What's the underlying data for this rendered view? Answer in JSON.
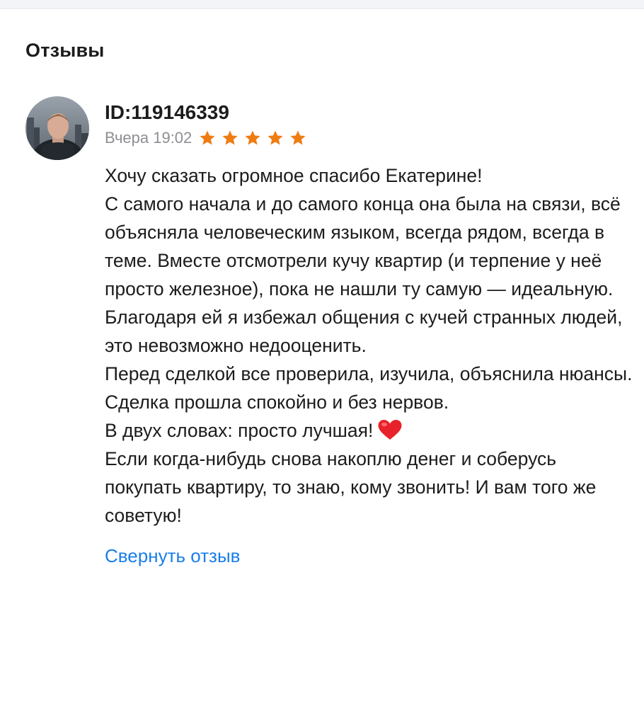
{
  "section": {
    "title": "Отзывы"
  },
  "review": {
    "author": "ID:119146339",
    "date": "Вчера 19:02",
    "rating": 5,
    "lines": [
      "Хочу сказать огромное спасибо Екатерине!",
      "С самого начала и до самого конца она была на связи, всё объясняла человеческим языком, всегда рядом, всегда в теме. Вместе отсмотрели кучу квартир (и терпение у неё просто железное), пока не нашли ту самую — идеальную.",
      "Благодаря ей я избежал общения с кучей странных людей, это невозможно недооценить.",
      "Перед сделкой все проверила, изучила, объяснила нюансы. Сделка прошла спокойно и без нервов.",
      "В двух словах: просто лучшая!",
      "Если когда-нибудь снова накоплю денег и соберусь покупать квартиру, то знаю, кому звонить! И вам того же советую!"
    ],
    "collapse_label": "Свернуть отзыв"
  },
  "colors": {
    "star": "#ef7c13",
    "link": "#1a7ee8",
    "text": "#1c1c1e",
    "muted": "#8e8e93",
    "heart": "#e8222a"
  },
  "icons": {
    "rating": "star-icon",
    "emoji": "heart-icon"
  }
}
